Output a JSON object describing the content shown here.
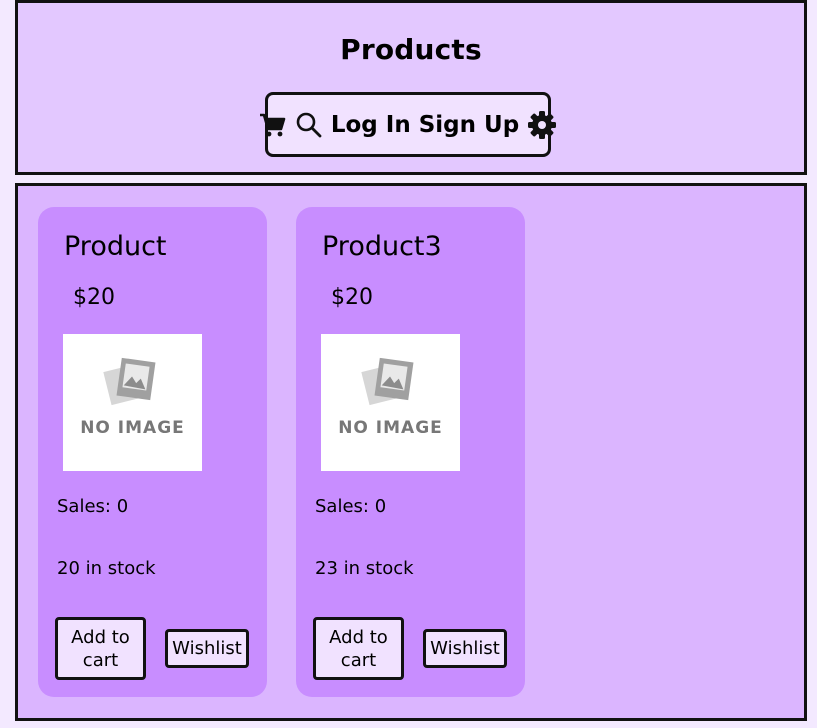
{
  "header": {
    "title": "Products",
    "nav": {
      "login": "Log In",
      "signup": "Sign Up",
      "icons": [
        "cart-icon",
        "search-icon",
        "gear-icon"
      ]
    }
  },
  "products": [
    {
      "name": "Product",
      "price": "$20",
      "image_placeholder": "NO IMAGE",
      "sales": "Sales: 0",
      "stock": "20 in stock",
      "add_to_cart": "Add to cart",
      "wishlist": "Wishlist"
    },
    {
      "name": "Product3",
      "price": "$20",
      "image_placeholder": "NO IMAGE",
      "sales": "Sales: 0",
      "stock": "23 in stock",
      "add_to_cart": "Add to cart",
      "wishlist": "Wishlist"
    }
  ],
  "colors": {
    "page_bg": "#f3e9ff",
    "header_bg": "#e3c8ff",
    "main_bg": "#dbb5ff",
    "card_bg": "#c88dff",
    "button_bg": "#f1e2ff"
  }
}
